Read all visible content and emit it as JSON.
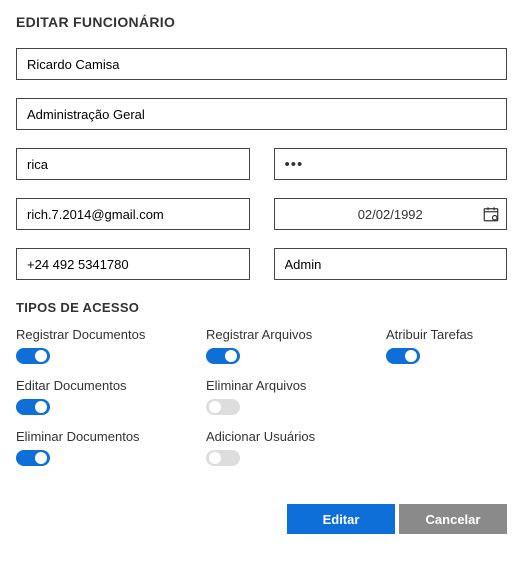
{
  "form": {
    "title": "EDITAR FUNCIONÁRIO",
    "name": "Ricardo Camisa",
    "department": "Administração Geral",
    "username": "rica",
    "password": "•••",
    "email": "rich.7.2014@gmail.com",
    "birthdate": "02/02/1992",
    "phone": "+24 492 5341780",
    "role": "Admin"
  },
  "access": {
    "section_title": "TIPOS DE ACESSO",
    "permissions": [
      {
        "label": "Registrar Documentos",
        "enabled": true
      },
      {
        "label": "Registrar Arquivos",
        "enabled": true
      },
      {
        "label": "Atribuir Tarefas",
        "enabled": true
      },
      {
        "label": "Editar Documentos",
        "enabled": true
      },
      {
        "label": "Eliminar Arquivos",
        "enabled": false
      },
      {
        "label": "",
        "enabled": null
      },
      {
        "label": "Eliminar Documentos",
        "enabled": true
      },
      {
        "label": "Adicionar Usuários",
        "enabled": false
      },
      {
        "label": "",
        "enabled": null
      }
    ]
  },
  "buttons": {
    "submit": "Editar",
    "cancel": "Cancelar"
  }
}
